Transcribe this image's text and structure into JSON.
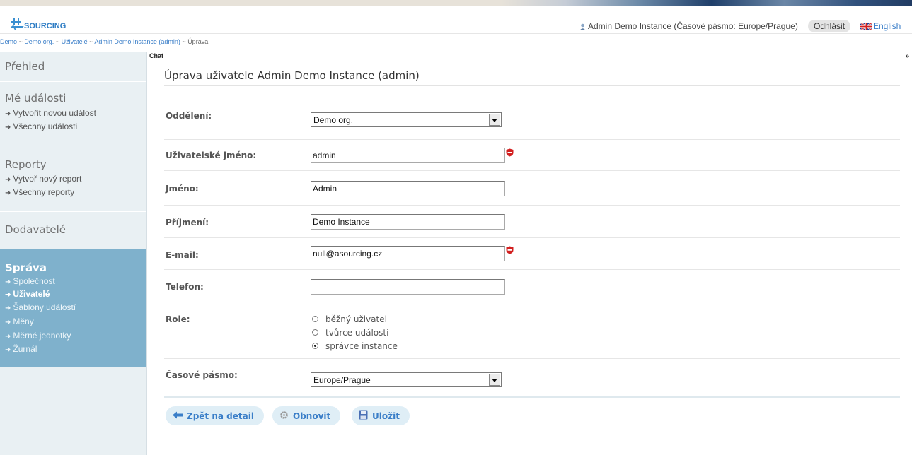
{
  "header": {
    "logo_text": "SOURCING",
    "user_info": "Admin Demo Instance (Časové pásmo: Europe/Prague)",
    "logout": "Odhlásit",
    "language": "English"
  },
  "breadcrumb": {
    "items": [
      "Demo",
      "Demo org.",
      "Uživatelé",
      "Admin Demo Instance (admin)"
    ],
    "current": "Úprava",
    "separator": " ~ "
  },
  "sidebar": {
    "prehled": "Přehled",
    "events": {
      "title": "Mé události",
      "links": [
        "Vytvořit novou událost",
        "Všechny události"
      ]
    },
    "reports": {
      "title": "Reporty",
      "links": [
        "Vytvoř nový report",
        "Všechny reporty"
      ]
    },
    "suppliers": "Dodavatelé",
    "admin": {
      "title": "Správa",
      "links": [
        "Společnost",
        "Uživatelé",
        "Šablony událostí",
        "Měny",
        "Měrné jednotky",
        "Žurnál"
      ],
      "active_index": 1
    }
  },
  "chat": {
    "label": "Chat",
    "toggle": "»"
  },
  "form": {
    "title": "Úprava uživatele Admin Demo Instance (admin)",
    "department": {
      "label": "Oddělení:",
      "value": "Demo org."
    },
    "username": {
      "label": "Uživatelské jméno:",
      "value": "admin",
      "required": true
    },
    "first_name": {
      "label": "Jméno:",
      "value": "Admin"
    },
    "last_name": {
      "label": "Příjmení:",
      "value": "Demo Instance"
    },
    "email": {
      "label": "E-mail:",
      "value": "null@asourcing.cz",
      "required": true
    },
    "phone": {
      "label": "Telefon:",
      "value": ""
    },
    "role": {
      "label": "Role:",
      "options": [
        "běžný uživatel",
        "tvůrce události",
        "správce instance"
      ],
      "selected": "správce instance"
    },
    "timezone": {
      "label": "Časové pásmo:",
      "value": "Europe/Prague"
    }
  },
  "buttons": {
    "back": "Zpět na detail",
    "refresh": "Obnovit",
    "save": "Uložit"
  },
  "colors": {
    "accent": "#3a7ec8",
    "sidebar_bg": "#e9f0f3",
    "admin_bg": "#7fb1cc",
    "required": "#d22020"
  },
  "icons": [
    "user-icon",
    "uk-flag-icon",
    "required-icon",
    "arrow-left-icon",
    "gear-icon",
    "floppy-icon"
  ]
}
